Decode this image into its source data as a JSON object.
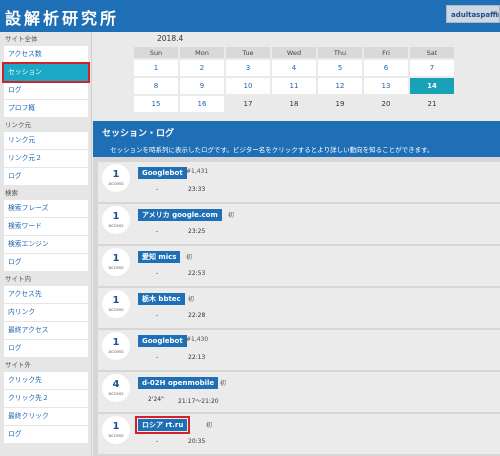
{
  "header": {
    "logo": "設解析研究所",
    "user": "adultaspaffiri"
  },
  "sidebar": {
    "sections": [
      {
        "head": "サイト全体",
        "items": [
          "アクセス数",
          "セッション",
          "ログ",
          "プロフ概"
        ]
      },
      {
        "head": "リンク元",
        "items": [
          "リンク元",
          "リンク元２",
          "ログ"
        ]
      },
      {
        "head": "検索",
        "items": [
          "検索フレーズ",
          "検索ワード",
          "検索エンジン",
          "ログ"
        ]
      },
      {
        "head": "サイト内",
        "items": [
          "アクセス先",
          "内リンク",
          "最終アクセス",
          "ログ"
        ]
      },
      {
        "head": "サイト外",
        "items": [
          "クリック先",
          "クリック先２",
          "最終クリック",
          "ログ"
        ]
      }
    ]
  },
  "calendar": {
    "month": "2018.4",
    "weekdays": [
      "Sun",
      "Mon",
      "Tue",
      "Wed",
      "Thu",
      "Fri",
      "Sat"
    ],
    "weeks": [
      [
        "1",
        "2",
        "3",
        "4",
        "5",
        "6",
        "7"
      ],
      [
        "8",
        "9",
        "10",
        "11",
        "12",
        "13",
        "14"
      ],
      [
        "15",
        "16",
        "17",
        "18",
        "19",
        "20",
        "21"
      ]
    ]
  },
  "panel": {
    "title": "セッション・ログ",
    "desc": "セッションを時系列に表示したログです。ビジター名をクリックするとより詳しい動向を知ることができます。"
  },
  "entries": [
    {
      "count": "1",
      "unit": "access",
      "visitor": "Googlebot",
      "tag": "#1,431",
      "dur": "-",
      "time": "23:33"
    },
    {
      "count": "1",
      "unit": "access",
      "visitor": "アメリカ google.com",
      "tag": "初",
      "dur": "-",
      "time": "23:25"
    },
    {
      "count": "1",
      "unit": "access",
      "visitor": "愛知 mics",
      "tag": "初",
      "dur": "-",
      "time": "22:53"
    },
    {
      "count": "1",
      "unit": "access",
      "visitor": "栃木 bbtec",
      "tag": "初",
      "dur": "-",
      "time": "22:28"
    },
    {
      "count": "1",
      "unit": "access",
      "visitor": "Googlebot",
      "tag": "#1,430",
      "dur": "-",
      "time": "22:13"
    },
    {
      "count": "4",
      "unit": "access",
      "visitor": "d-02H openmobile",
      "tag": "初",
      "dur": "2'24\"",
      "time": "21:17～21:20"
    },
    {
      "count": "1",
      "unit": "access",
      "visitor": "ロシア rt.ru",
      "tag": "初",
      "dur": "-",
      "time": "20:35"
    }
  ]
}
